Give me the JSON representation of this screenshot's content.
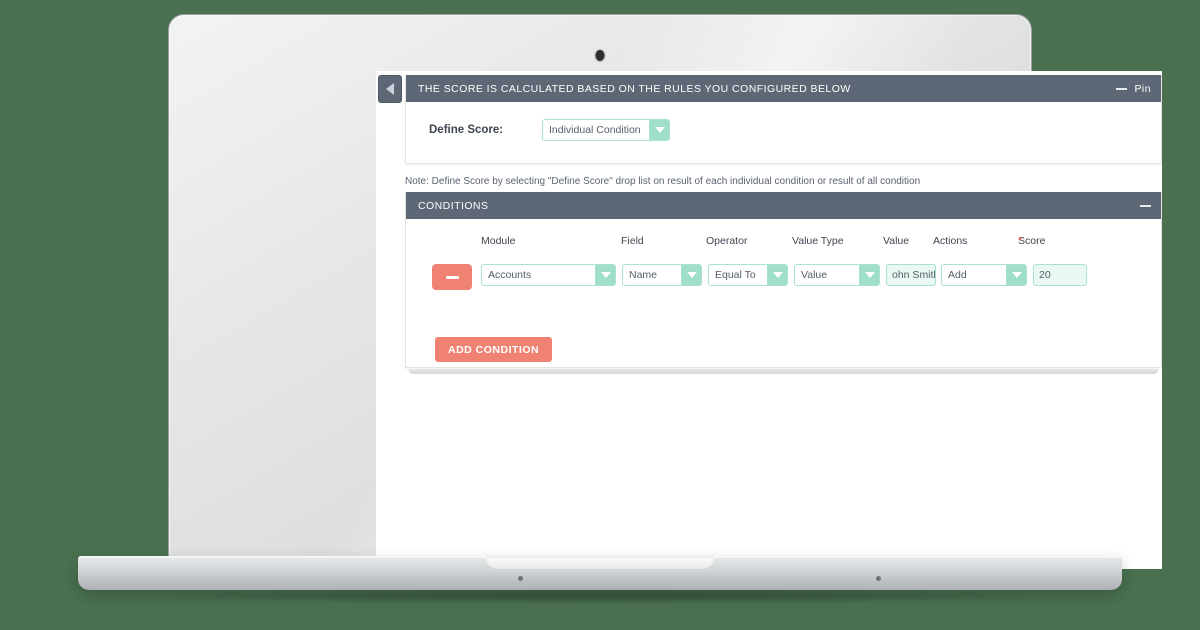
{
  "app": {
    "collapse_icon": "caret-left-icon"
  },
  "score_panel": {
    "title": "THE SCORE IS CALCULATED BASED ON THE RULES YOU CONFIGURED BELOW",
    "minimize_icon": "minimize-icon",
    "pin_label": "Pin",
    "define_score_label": "Define Score:",
    "define_score_value": "Individual Condition",
    "dropdown_icon": "chevron-down-icon"
  },
  "note": "Note: Define Score by selecting \"Define Score\" drop list on result of each individual condition or result of all condition",
  "conditions_panel": {
    "title": "CONDITIONS",
    "minimize_icon": "minimize-icon",
    "columns": [
      "Module",
      "Field",
      "Operator",
      "Value Type",
      "Value",
      "Actions",
      "Score"
    ],
    "score_required_marker": "*",
    "rows": [
      {
        "remove_icon": "minus-icon",
        "module": "Accounts",
        "field": "Name",
        "operator": "Equal To",
        "value_type": "Value",
        "value": "ohn Smith",
        "action": "Add",
        "score": "20"
      }
    ],
    "add_condition_label": "ADD CONDITION"
  },
  "colors": {
    "background": "#4a7050",
    "panel_header": "#5d6775",
    "accent_mint": "#9fdfc8",
    "accent_coral": "#ef8273",
    "required_red": "#ef6e5c"
  }
}
